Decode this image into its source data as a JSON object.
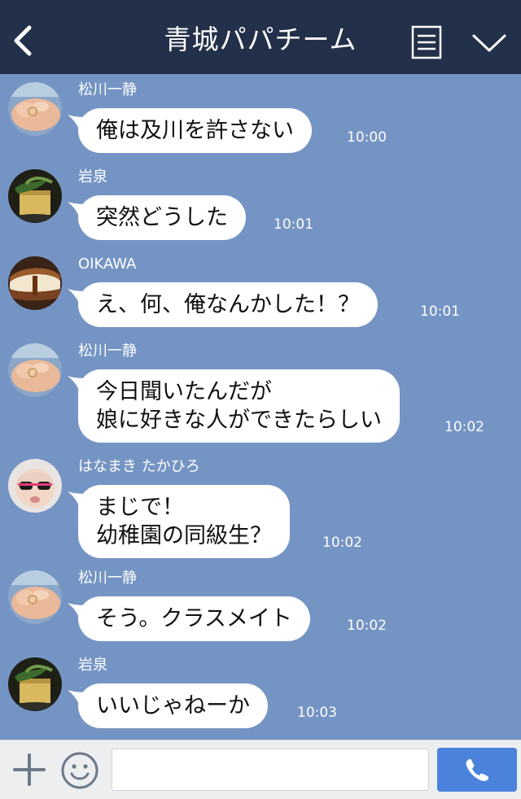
{
  "header": {
    "title": "青城パパチーム",
    "back_icon": "chevron-left-icon",
    "menu_icon": "list-icon",
    "collapse_icon": "chevron-down-icon",
    "background": "#23304a"
  },
  "chat": {
    "background": "#7494c4",
    "messages": [
      {
        "sender": "松川一静",
        "lines": [
          "俺は及川を許さない"
        ],
        "time": "10:00"
      },
      {
        "sender": "岩泉",
        "lines": [
          "突然どうした"
        ],
        "time": "10:01"
      },
      {
        "sender": "OIKAWA",
        "lines": [
          "え、何、俺なんかした！？"
        ],
        "time": "10:01"
      },
      {
        "sender": "松川一静",
        "lines": [
          "今日聞いたんだが",
          "娘に好きな人ができたらしい"
        ],
        "time": "10:02"
      },
      {
        "sender": "はなまき たかひろ",
        "lines": [
          "まじで！",
          "幼稚園の同級生？"
        ],
        "time": "10:02"
      },
      {
        "sender": "松川一静",
        "lines": [
          "そう。クラスメイト"
        ],
        "time": "10:02"
      },
      {
        "sender": "岩泉",
        "lines": [
          "いいじゃねーか"
        ],
        "time": "10:03"
      }
    ]
  },
  "input": {
    "plus_icon": "plus-icon",
    "emoji_icon": "smiley-icon",
    "placeholder": "",
    "value": "",
    "call_icon": "phone-icon",
    "call_color": "#4a82dc"
  }
}
